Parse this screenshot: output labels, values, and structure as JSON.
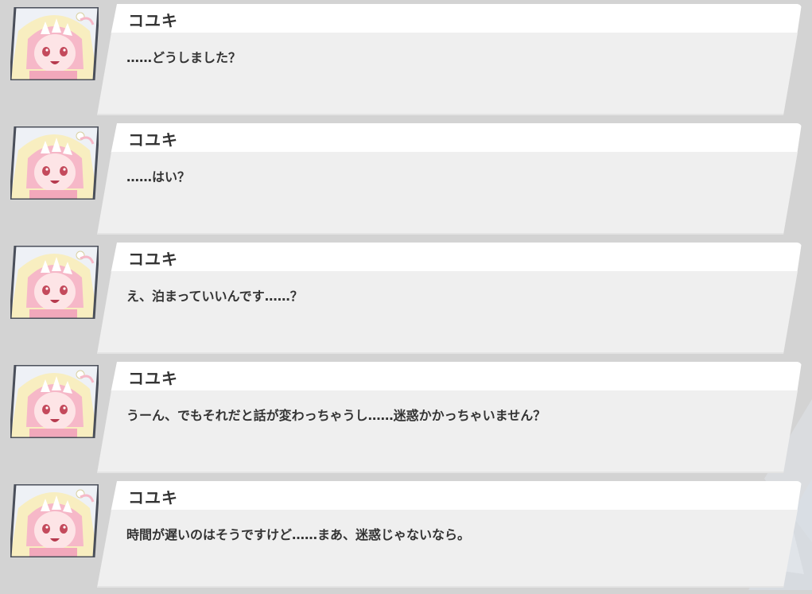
{
  "backlog": {
    "entries": [
      {
        "speaker": "コユキ",
        "text": "……どうしました？"
      },
      {
        "speaker": "コユキ",
        "text": "……はい？"
      },
      {
        "speaker": "コユキ",
        "text": "え、泊まっていいんです……？"
      },
      {
        "speaker": "コユキ",
        "text": "うーん、でもそれだと話が変わっちゃうし……迷惑かかっちゃいません？"
      },
      {
        "speaker": "コユキ",
        "text": "時間が遅いのはそうですけど……まあ、迷惑じゃないなら。"
      }
    ]
  },
  "colors": {
    "background": "#d3d3d3",
    "name_bar": "#ffffff",
    "text_panel": "#efefef",
    "text": "#333333",
    "avatar_hair": "#f6b8c8",
    "avatar_hood": "#f8eec0"
  },
  "icons": {
    "avatar": "character-portrait-koyuki"
  }
}
